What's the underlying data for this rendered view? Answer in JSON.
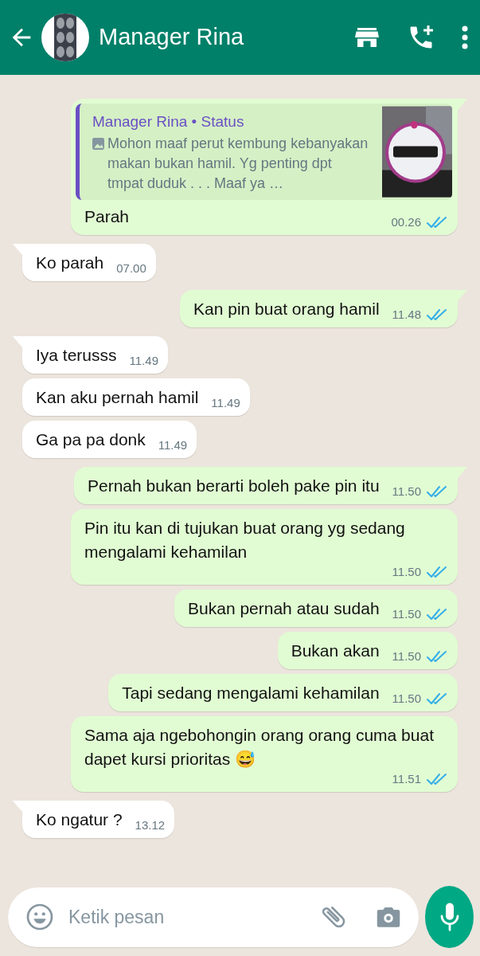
{
  "header": {
    "title": "Manager Rina"
  },
  "messages": [
    {
      "kind": "quote",
      "outgoing": true,
      "tail": true,
      "quote": {
        "author": "Manager Rina • Status",
        "text": "Mohon maaf perut kembung kebanyakan makan bukan hamil. Yg penting dpt tmpat duduk . . . Maaf ya …",
        "kind": "picture"
      },
      "text": "Parah",
      "time": "00.26",
      "read": true
    },
    {
      "kind": "text",
      "outgoing": false,
      "tail": true,
      "text": "Ko parah",
      "time": "07.00"
    },
    {
      "kind": "text",
      "outgoing": true,
      "tail": true,
      "text": "Kan pin buat orang hamil",
      "time": "11.48",
      "read": true
    },
    {
      "kind": "text",
      "outgoing": false,
      "tail": true,
      "text": "Iya terusss",
      "time": "11.49"
    },
    {
      "kind": "text",
      "outgoing": false,
      "tail": false,
      "text": "Kan aku pernah hamil",
      "time": "11.49"
    },
    {
      "kind": "text",
      "outgoing": false,
      "tail": false,
      "text": "Ga pa pa donk",
      "time": "11.49"
    },
    {
      "kind": "text",
      "outgoing": true,
      "tail": true,
      "text": "Pernah bukan berarti boleh pake pin itu",
      "time": "11.50",
      "read": true
    },
    {
      "kind": "text",
      "outgoing": true,
      "tail": false,
      "text": "Pin itu kan di tujukan buat orang yg sedang mengalami kehamilan",
      "time": "11.50",
      "read": true
    },
    {
      "kind": "text",
      "outgoing": true,
      "tail": false,
      "text": "Bukan pernah atau sudah",
      "time": "11.50",
      "read": true
    },
    {
      "kind": "text",
      "outgoing": true,
      "tail": false,
      "text": "Bukan akan",
      "time": "11.50",
      "read": true
    },
    {
      "kind": "text",
      "outgoing": true,
      "tail": false,
      "text": "Tapi sedang mengalami kehamilan",
      "time": "11.50",
      "read": true
    },
    {
      "kind": "text",
      "outgoing": true,
      "tail": false,
      "text": "Sama aja ngebohongin orang orang cuma buat dapet kursi prioritas 😅",
      "time": "11.51",
      "read": true
    },
    {
      "kind": "text",
      "outgoing": false,
      "tail": true,
      "text": "Ko ngatur ?",
      "time": "13.12"
    }
  ],
  "composer": {
    "placeholder": "Ketik pesan"
  }
}
